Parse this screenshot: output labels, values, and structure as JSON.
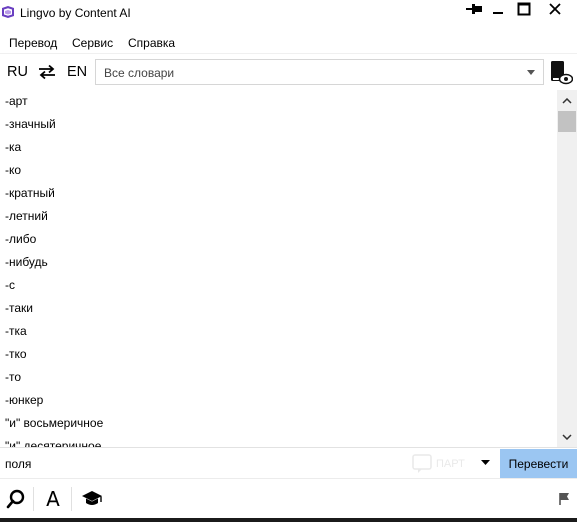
{
  "window": {
    "title": "Lingvo by Content AI",
    "controls": [
      "pin-icon",
      "minimize-icon",
      "maximize-icon",
      "close-icon"
    ]
  },
  "menu": {
    "items": [
      "Перевод",
      "Сервис",
      "Справка"
    ]
  },
  "langbar": {
    "source": "RU",
    "target": "EN",
    "dictionaries_placeholder": "Все словари"
  },
  "wordlist": {
    "items": [
      "-арт",
      "-значный",
      "-ка",
      "-ко",
      "-кратный",
      "-летний",
      "-либо",
      "-нибудь",
      "-с",
      "-таки",
      "-тка",
      "-тко",
      "-то",
      "-юнкер",
      "\"и\" восьмеричное",
      "\"и\" десятеричное"
    ]
  },
  "search": {
    "query": "поля",
    "translate_label": "Перевести",
    "watermark_text": "ПАРТ"
  },
  "colors": {
    "translate_button": "#9bc6f2",
    "scroll_thumb": "#c2c2c2",
    "logo": "#6a3fc1"
  },
  "toolbar": {
    "font_label": "A",
    "icons": [
      "search-icon",
      "font-icon",
      "graduation-cap-icon",
      "flag-icon"
    ]
  }
}
